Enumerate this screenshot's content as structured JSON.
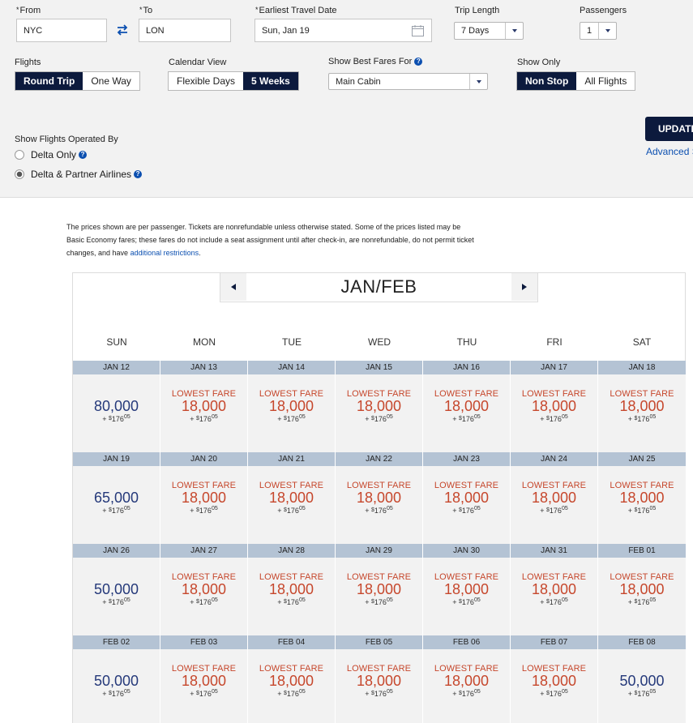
{
  "search": {
    "from_label": "From",
    "from_value": "NYC",
    "to_label": "To",
    "to_value": "LON",
    "date_label": "Earliest Travel Date",
    "date_value": "Sun, Jan 19",
    "trip_length_label": "Trip Length",
    "trip_length_value": "7 Days",
    "passengers_label": "Passengers",
    "passengers_value": "1",
    "required_mark": "*"
  },
  "flights": {
    "label": "Flights",
    "options": [
      "Round Trip",
      "One Way"
    ],
    "selected": "Round Trip"
  },
  "calendar_view": {
    "label": "Calendar View",
    "options": [
      "Flexible Days",
      "5 Weeks"
    ],
    "selected": "5 Weeks"
  },
  "best_fares": {
    "label": "Show Best Fares For",
    "value": "Main Cabin"
  },
  "show_only": {
    "label": "Show Only",
    "options": [
      "Non Stop",
      "All Flights"
    ],
    "selected": "Non Stop"
  },
  "operated_by": {
    "label": "Show Flights Operated By",
    "options": [
      "Delta Only",
      "Delta & Partner Airlines"
    ],
    "selected": "Delta & Partner Airlines"
  },
  "actions": {
    "update_label": "UPDATE",
    "advanced_label": "Advanced S"
  },
  "disclaimer": {
    "text": "The prices shown are per passenger. Tickets are nonrefundable unless otherwise stated. Some of the prices listed may be Basic Economy fares; these fares do not include a seat assignment until after check-in, are nonrefundable, do not permit ticket changes, and have",
    "link": "additional restrictions",
    "end": "."
  },
  "calendar": {
    "month_title": "JAN/FEB",
    "weekdays": [
      "SUN",
      "MON",
      "TUE",
      "WED",
      "THU",
      "FRI",
      "SAT"
    ],
    "lowest_label": "LOWEST FARE",
    "tax_prefix": "+ ",
    "tax_dollar": "$",
    "tax_whole": "176",
    "tax_cents": "05",
    "weeks": [
      [
        {
          "date": "JAN 12",
          "miles": "80,000",
          "lowest": false
        },
        {
          "date": "JAN 13",
          "miles": "18,000",
          "lowest": true
        },
        {
          "date": "JAN 14",
          "miles": "18,000",
          "lowest": true
        },
        {
          "date": "JAN 15",
          "miles": "18,000",
          "lowest": true
        },
        {
          "date": "JAN 16",
          "miles": "18,000",
          "lowest": true
        },
        {
          "date": "JAN 17",
          "miles": "18,000",
          "lowest": true
        },
        {
          "date": "JAN 18",
          "miles": "18,000",
          "lowest": true
        }
      ],
      [
        {
          "date": "JAN 19",
          "miles": "65,000",
          "lowest": false
        },
        {
          "date": "JAN 20",
          "miles": "18,000",
          "lowest": true
        },
        {
          "date": "JAN 21",
          "miles": "18,000",
          "lowest": true
        },
        {
          "date": "JAN 22",
          "miles": "18,000",
          "lowest": true
        },
        {
          "date": "JAN 23",
          "miles": "18,000",
          "lowest": true
        },
        {
          "date": "JAN 24",
          "miles": "18,000",
          "lowest": true
        },
        {
          "date": "JAN 25",
          "miles": "18,000",
          "lowest": true
        }
      ],
      [
        {
          "date": "JAN 26",
          "miles": "50,000",
          "lowest": false
        },
        {
          "date": "JAN 27",
          "miles": "18,000",
          "lowest": true
        },
        {
          "date": "JAN 28",
          "miles": "18,000",
          "lowest": true
        },
        {
          "date": "JAN 29",
          "miles": "18,000",
          "lowest": true
        },
        {
          "date": "JAN 30",
          "miles": "18,000",
          "lowest": true
        },
        {
          "date": "JAN 31",
          "miles": "18,000",
          "lowest": true
        },
        {
          "date": "FEB 01",
          "miles": "18,000",
          "lowest": true
        }
      ],
      [
        {
          "date": "FEB 02",
          "miles": "50,000",
          "lowest": false
        },
        {
          "date": "FEB 03",
          "miles": "18,000",
          "lowest": true
        },
        {
          "date": "FEB 04",
          "miles": "18,000",
          "lowest": true
        },
        {
          "date": "FEB 05",
          "miles": "18,000",
          "lowest": true
        },
        {
          "date": "FEB 06",
          "miles": "18,000",
          "lowest": true
        },
        {
          "date": "FEB 07",
          "miles": "18,000",
          "lowest": true
        },
        {
          "date": "FEB 08",
          "miles": "50,000",
          "lowest": false
        }
      ]
    ]
  },
  "colors": {
    "navy": "#0c1a3d",
    "fare_red": "#c6472c",
    "miles_blue": "#25397a",
    "header_blue": "#b4c3d4",
    "link_blue": "#0b4fb0"
  }
}
